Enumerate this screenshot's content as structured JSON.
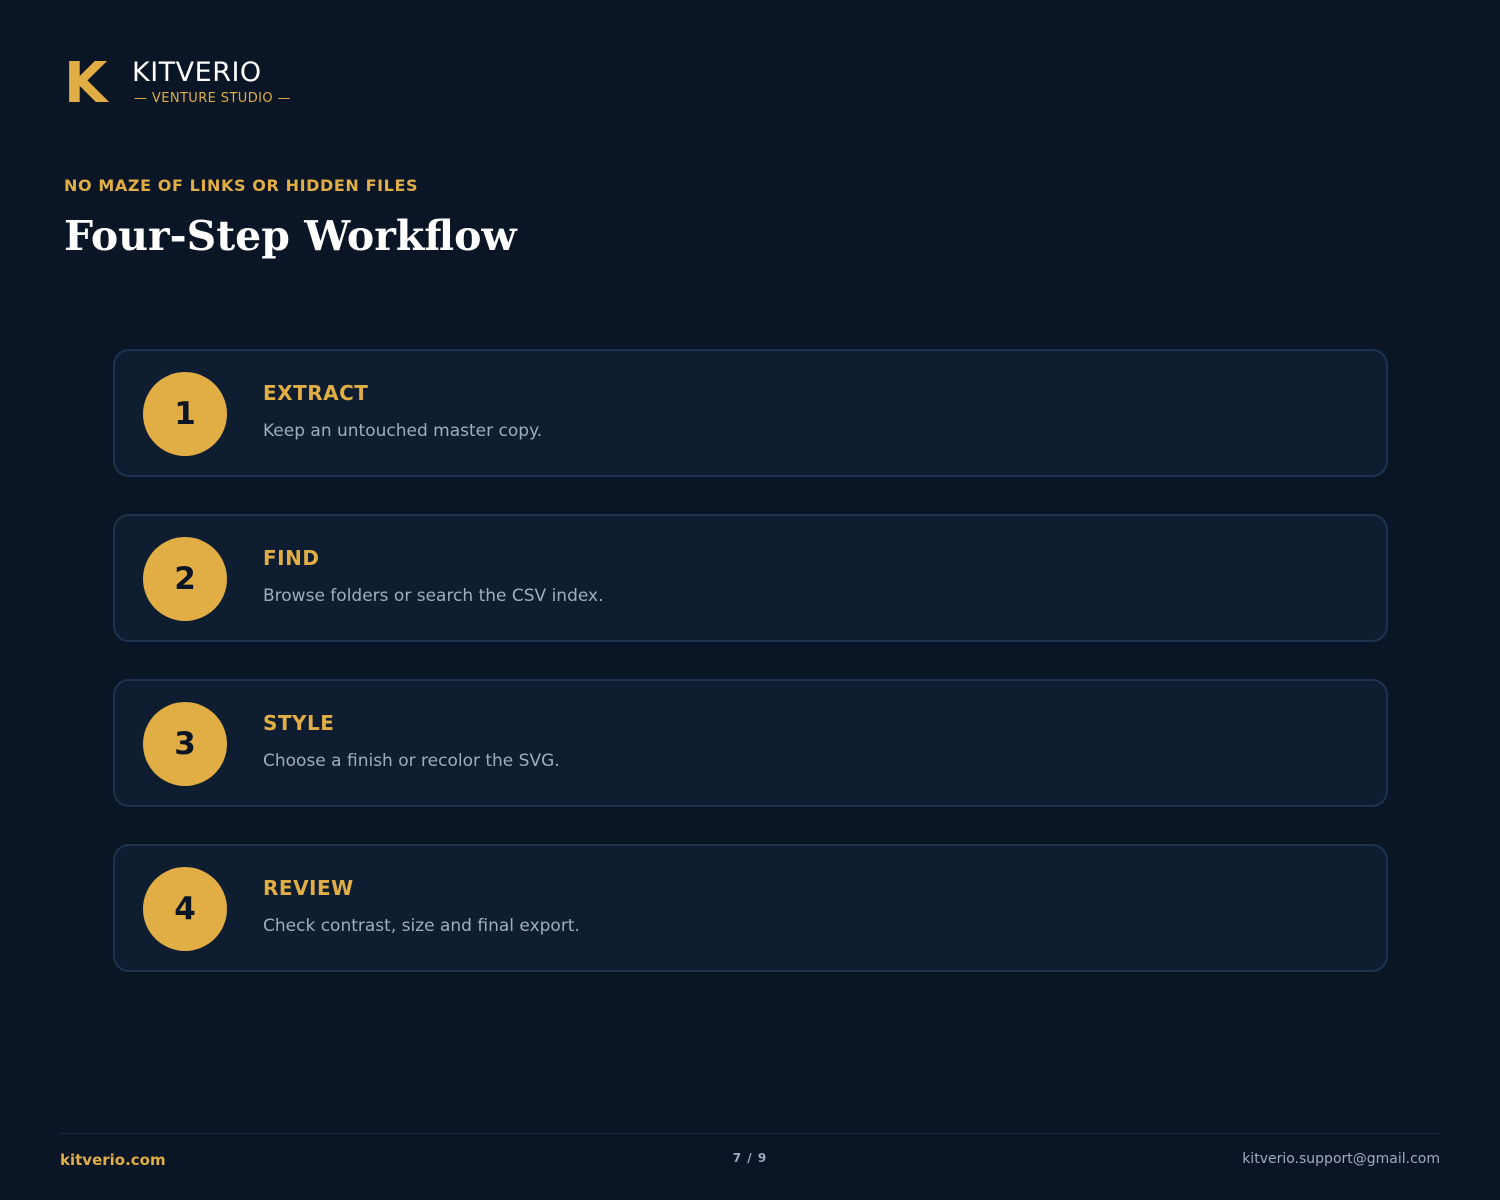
{
  "brand": {
    "mark": "K",
    "name": "KITVERIO",
    "tagline": "— VENTURE STUDIO —"
  },
  "header": {
    "eyebrow": "NO MAZE OF LINKS OR HIDDEN FILES",
    "title": "Four-Step Workflow"
  },
  "steps": [
    {
      "number": "1",
      "title": "EXTRACT",
      "description": "Keep an untouched master copy."
    },
    {
      "number": "2",
      "title": "FIND",
      "description": "Browse folders or search the CSV index."
    },
    {
      "number": "3",
      "title": "STYLE",
      "description": "Choose a finish or recolor the SVG."
    },
    {
      "number": "4",
      "title": "REVIEW",
      "description": "Check contrast, size and final export."
    }
  ],
  "footer": {
    "site": "kitverio.com",
    "page": "7 / 9",
    "email": "kitverio.support@gmail.com"
  },
  "colors": {
    "background": "#0a1525",
    "accent": "#e0ae44",
    "card": "#0f1d30",
    "card_border": "#1f3350",
    "muted_text": "#9fadc0"
  }
}
